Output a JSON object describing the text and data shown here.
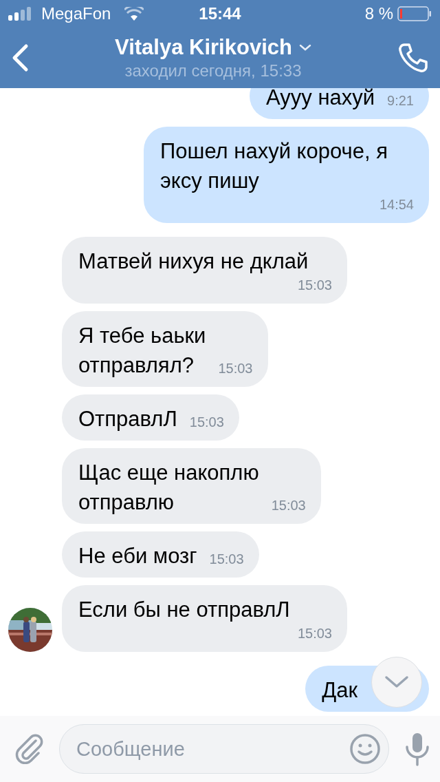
{
  "status_bar": {
    "carrier": "MegaFon",
    "time": "15:44",
    "battery": "8 %"
  },
  "header": {
    "title": "Vitalya Kirikovich",
    "subtitle": "заходил сегодня, 15:33"
  },
  "messages": [
    {
      "kind": "outgoing",
      "text": "Аууу нахуй",
      "time": "9:21"
    },
    {
      "kind": "outgoing",
      "text": "Пошел нахуй короче, я\nэксу пишу",
      "time": "14:54"
    },
    {
      "kind": "incoming",
      "text": "Матвей нихуя не дклай",
      "time": "15:03",
      "avatar": false
    },
    {
      "kind": "incoming",
      "text": "Я тебе ьаьки\nотправлял?",
      "time": "15:03",
      "avatar": false
    },
    {
      "kind": "incoming",
      "text": "ОтправлЛ",
      "time": "15:03",
      "avatar": false
    },
    {
      "kind": "incoming",
      "text": "Щас еще накоплю\nотправлю",
      "time": "15:03",
      "avatar": false
    },
    {
      "kind": "incoming",
      "text": "Не еби мозг",
      "time": "15:03",
      "avatar": false
    },
    {
      "kind": "incoming",
      "text": "Если бы не отправлЛ",
      "time": "15:03",
      "avatar": true
    },
    {
      "kind": "outgoing",
      "text": "Дак"
    }
  ],
  "composer": {
    "placeholder": "Сообщение"
  }
}
